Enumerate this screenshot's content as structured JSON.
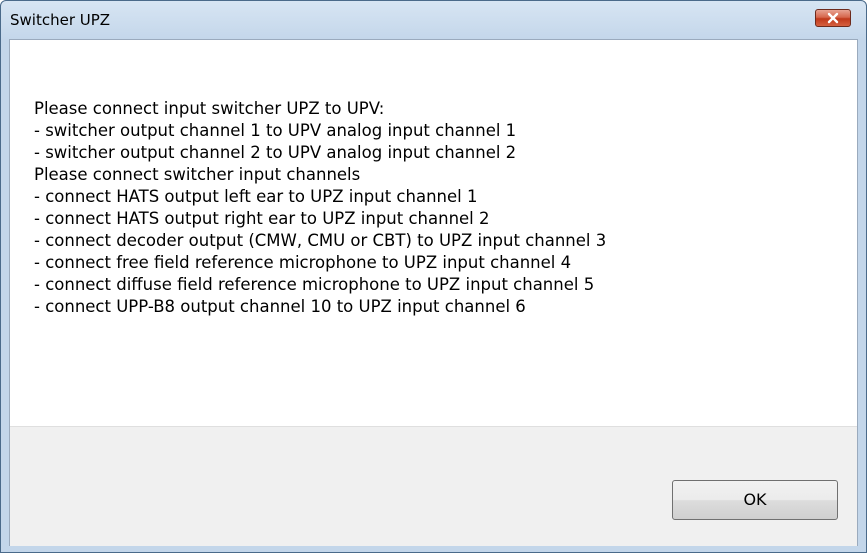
{
  "window": {
    "title": "Switcher UPZ"
  },
  "titlebar": {
    "close_icon": "close-icon"
  },
  "message": {
    "lines": [
      "Please connect input switcher UPZ to UPV:",
      "- switcher output channel 1 to UPV analog input channel 1",
      "- switcher output channel 2 to UPV analog input channel 2",
      "Please connect switcher input channels",
      "- connect HATS output left ear to UPZ input channel 1",
      "- connect HATS output right ear to UPZ input channel 2",
      "- connect decoder output (CMW, CMU or CBT) to UPZ input channel 3",
      "- connect free field reference microphone to UPZ input channel 4",
      "- connect diffuse field reference microphone to UPZ input channel 5",
      "- connect UPP-B8 output channel 10 to UPZ input channel 6"
    ]
  },
  "buttons": {
    "ok_label": "OK"
  },
  "colors": {
    "close_button": "#c7432a",
    "titlebar": "#c3d6ea",
    "button_area": "#f0f0f0"
  }
}
